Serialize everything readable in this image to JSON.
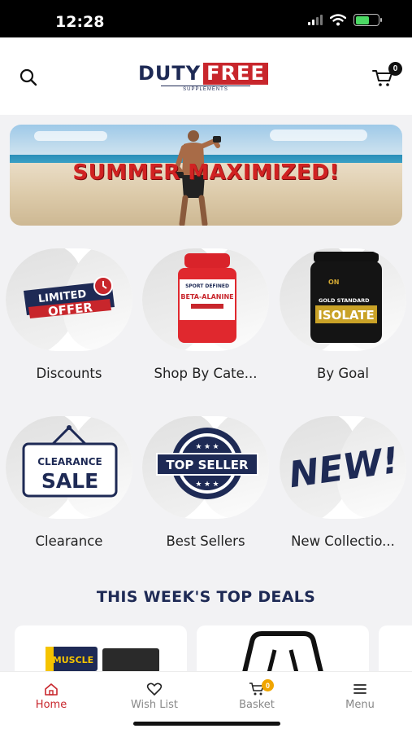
{
  "status_bar": {
    "time": "12:28"
  },
  "header": {
    "logo_duty": "DUTY",
    "logo_free": "FREE",
    "logo_sub": "SUPPLEMENTS",
    "cart_count": "0"
  },
  "banner": {
    "text": "SUMMER MAXIMIZED!"
  },
  "categories": [
    {
      "label": "Discounts",
      "badge_text": [
        "LIMITED",
        "OFFER"
      ]
    },
    {
      "label": "Shop By Cate...",
      "product_brand": "SPORT DEFINED",
      "product_name": "BETA-ALANINE"
    },
    {
      "label": "By Goal",
      "product_brand": "GOLD STANDARD",
      "product_name": "ISOLATE"
    },
    {
      "label": "Clearance",
      "sign_top": "CLEARANCE",
      "sign_bottom": "SALE"
    },
    {
      "label": "Best Sellers",
      "seal_text": "TOP SELLER"
    },
    {
      "label": "New Collectio...",
      "graphic_text": "NEW!"
    }
  ],
  "deals": {
    "title": "THIS WEEK'S TOP DEALS",
    "card1_brand": "MUSCLE"
  },
  "tab_bar": {
    "items": [
      {
        "label": "Home",
        "icon": "home-icon",
        "active": true
      },
      {
        "label": "Wish List",
        "icon": "heart-icon",
        "active": false
      },
      {
        "label": "Basket",
        "icon": "cart-icon",
        "active": false,
        "badge": "0"
      },
      {
        "label": "Menu",
        "icon": "menu-icon",
        "active": false
      }
    ]
  },
  "colors": {
    "brand_navy": "#1e2a55",
    "brand_red": "#c8262c",
    "active_tab": "#c8262c",
    "basket_badge": "#f0a500"
  }
}
